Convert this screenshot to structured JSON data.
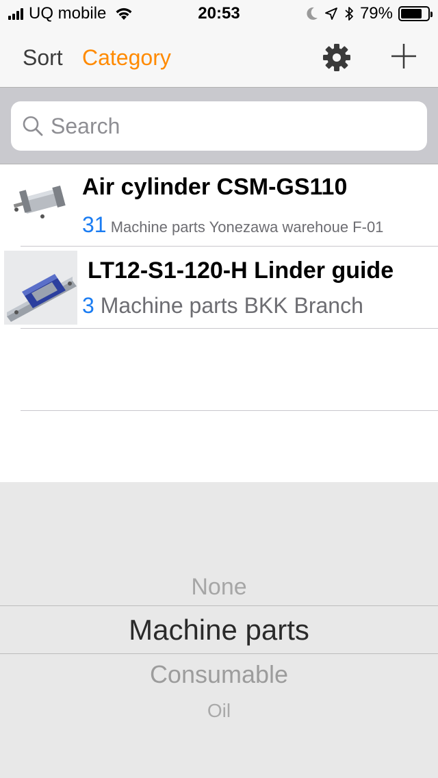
{
  "status_bar": {
    "carrier": "UQ mobile",
    "time": "20:53",
    "battery_percent": "79%",
    "battery_level": 0.79,
    "icons": [
      "signal-icon",
      "wifi-icon",
      "moon-icon",
      "location-arrow-icon",
      "bluetooth-icon",
      "battery-icon"
    ]
  },
  "nav": {
    "sort_label": "Sort",
    "category_label": "Category",
    "icons": [
      "gear-icon",
      "plus-icon"
    ],
    "accent_color": "#ff8a00"
  },
  "search": {
    "placeholder": "Search",
    "value": ""
  },
  "items": [
    {
      "title": "Air cylinder CSM-GS110",
      "count": "31",
      "details": "Machine parts Yonezawa warehoue F-01",
      "thumbnail": "air-cylinder-image"
    },
    {
      "title": "LT12-S1-120-H Linder guide",
      "count": "3",
      "details": "Machine parts BKK Branch",
      "thumbnail": "linear-guide-image"
    }
  ],
  "picker": {
    "options": [
      "None",
      "Machine parts",
      "Consumable",
      "Oil"
    ],
    "selected": "Machine parts"
  },
  "colors": {
    "count_blue": "#1a7cf2",
    "search_bg": "#c9c9ce",
    "picker_bg": "#e8e8e8"
  }
}
